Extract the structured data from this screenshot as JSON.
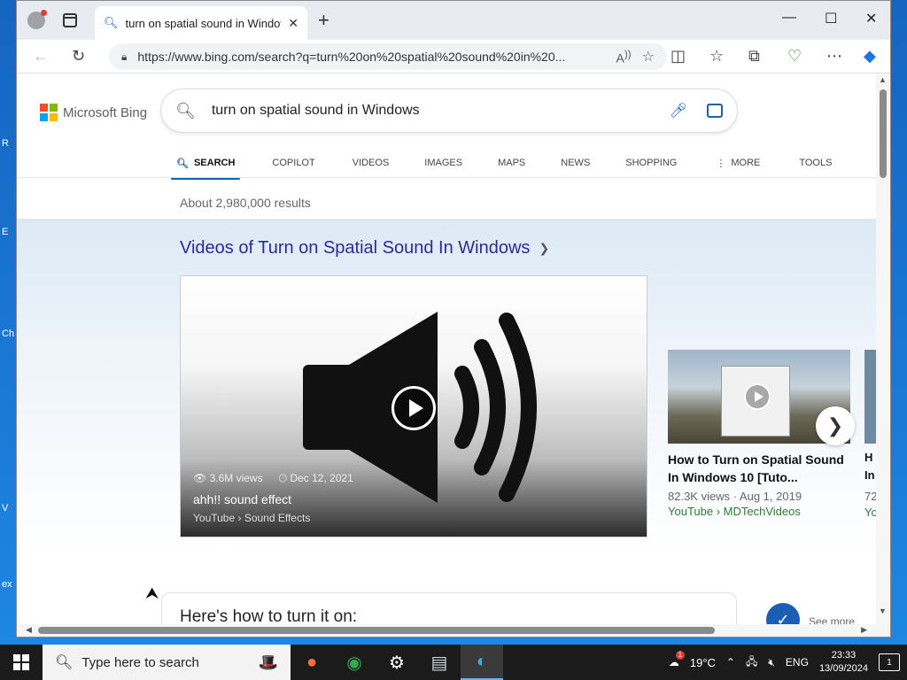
{
  "desktop": {
    "fragments": [
      "R",
      "E",
      "Ch",
      "V",
      "ex"
    ]
  },
  "browser": {
    "tab_title": "turn on spatial sound in Windows",
    "url": "https://www.bing.com/search?q=turn%20on%20spatial%20sound%20in%20...",
    "window_controls": {
      "minimize": "—",
      "maximize": "☐",
      "close": "✕"
    }
  },
  "bing": {
    "logo_text": "Microsoft Bing",
    "query": "turn on spatial sound in Windows",
    "nav": [
      {
        "label": "SEARCH",
        "active": true
      },
      {
        "label": "COPILOT"
      },
      {
        "label": "VIDEOS"
      },
      {
        "label": "IMAGES"
      },
      {
        "label": "MAPS"
      },
      {
        "label": "NEWS"
      },
      {
        "label": "SHOPPING"
      },
      {
        "label": "MORE"
      },
      {
        "label": "TOOLS"
      }
    ],
    "result_count": "About 2,980,000 results",
    "videos_heading": "Videos of Turn on Spatial Sound In Windows",
    "main_video": {
      "views": "3.6M views",
      "date": "Dec 12, 2021",
      "title": "ahh!! sound effect",
      "source": "YouTube › Sound Effects"
    },
    "side_video": {
      "title": "How to Turn on Spatial Sound In Windows 10 [Tuto...",
      "meta": "82.3K views · Aug 1, 2019",
      "source": "YouTube › MDTechVideos"
    },
    "partial_card": {
      "title1": "H",
      "title2": "In",
      "meta": "72",
      "source": "Yo"
    },
    "howto_heading": "Here's how to turn it on:",
    "see_more": "See more"
  },
  "taskbar": {
    "search_placeholder": "Type here to search",
    "weather": "19°C",
    "weather_badge": "1",
    "language": "ENG",
    "time": "23:33",
    "date": "13/09/2024",
    "notification_count": "1"
  }
}
